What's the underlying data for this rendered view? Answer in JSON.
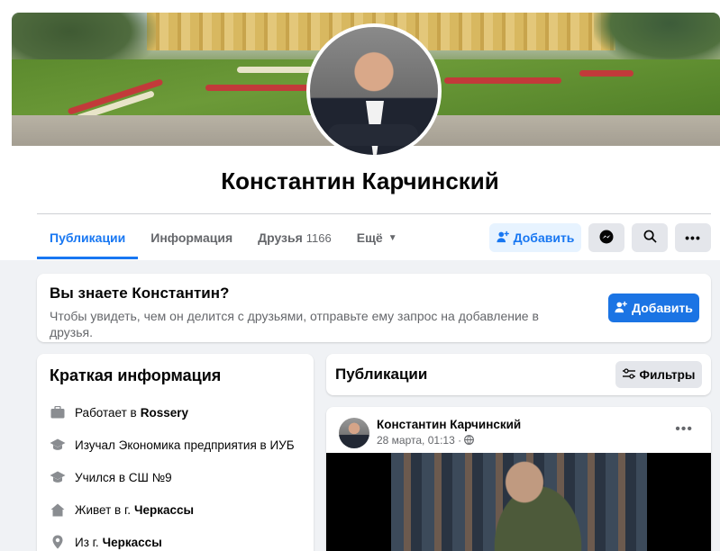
{
  "profile": {
    "name": "Константин Карчинский"
  },
  "tabs": [
    {
      "label": "Публикации",
      "active": true
    },
    {
      "label": "Информация"
    },
    {
      "label": "Друзья",
      "count": "1166"
    },
    {
      "label": "Ещё"
    }
  ],
  "actions": {
    "add_label": "Добавить",
    "messenger_icon": "messenger-icon",
    "search_icon": "search-icon",
    "more_icon": "ellipsis-icon"
  },
  "know_card": {
    "title": "Вы знаете Константин?",
    "text": "Чтобы увидеть, чем он делится с друзьями, отправьте ему запрос на добавление в друзья.",
    "button": "Добавить"
  },
  "intro": {
    "title": "Краткая информация",
    "items": [
      {
        "icon": "briefcase-icon",
        "prefix": "Работает в",
        "value": "Rossery"
      },
      {
        "icon": "graduation-cap-icon",
        "prefix": "Изучал Экономика предприятия в ИУБ",
        "value": ""
      },
      {
        "icon": "graduation-cap-icon",
        "prefix": "Учился в СШ №9",
        "value": ""
      },
      {
        "icon": "home-icon",
        "prefix": "Живет в г.",
        "value": "Черкассы"
      },
      {
        "icon": "location-pin-icon",
        "prefix": "Из г.",
        "value": "Черкассы"
      }
    ]
  },
  "posts": {
    "title": "Публикации",
    "filter_label": "Фильтры",
    "first_post": {
      "author": "Константин Карчинский",
      "date": "28 марта, 01:13 ·"
    }
  },
  "colors": {
    "accent": "#1877f2",
    "background": "#f0f2f5"
  }
}
